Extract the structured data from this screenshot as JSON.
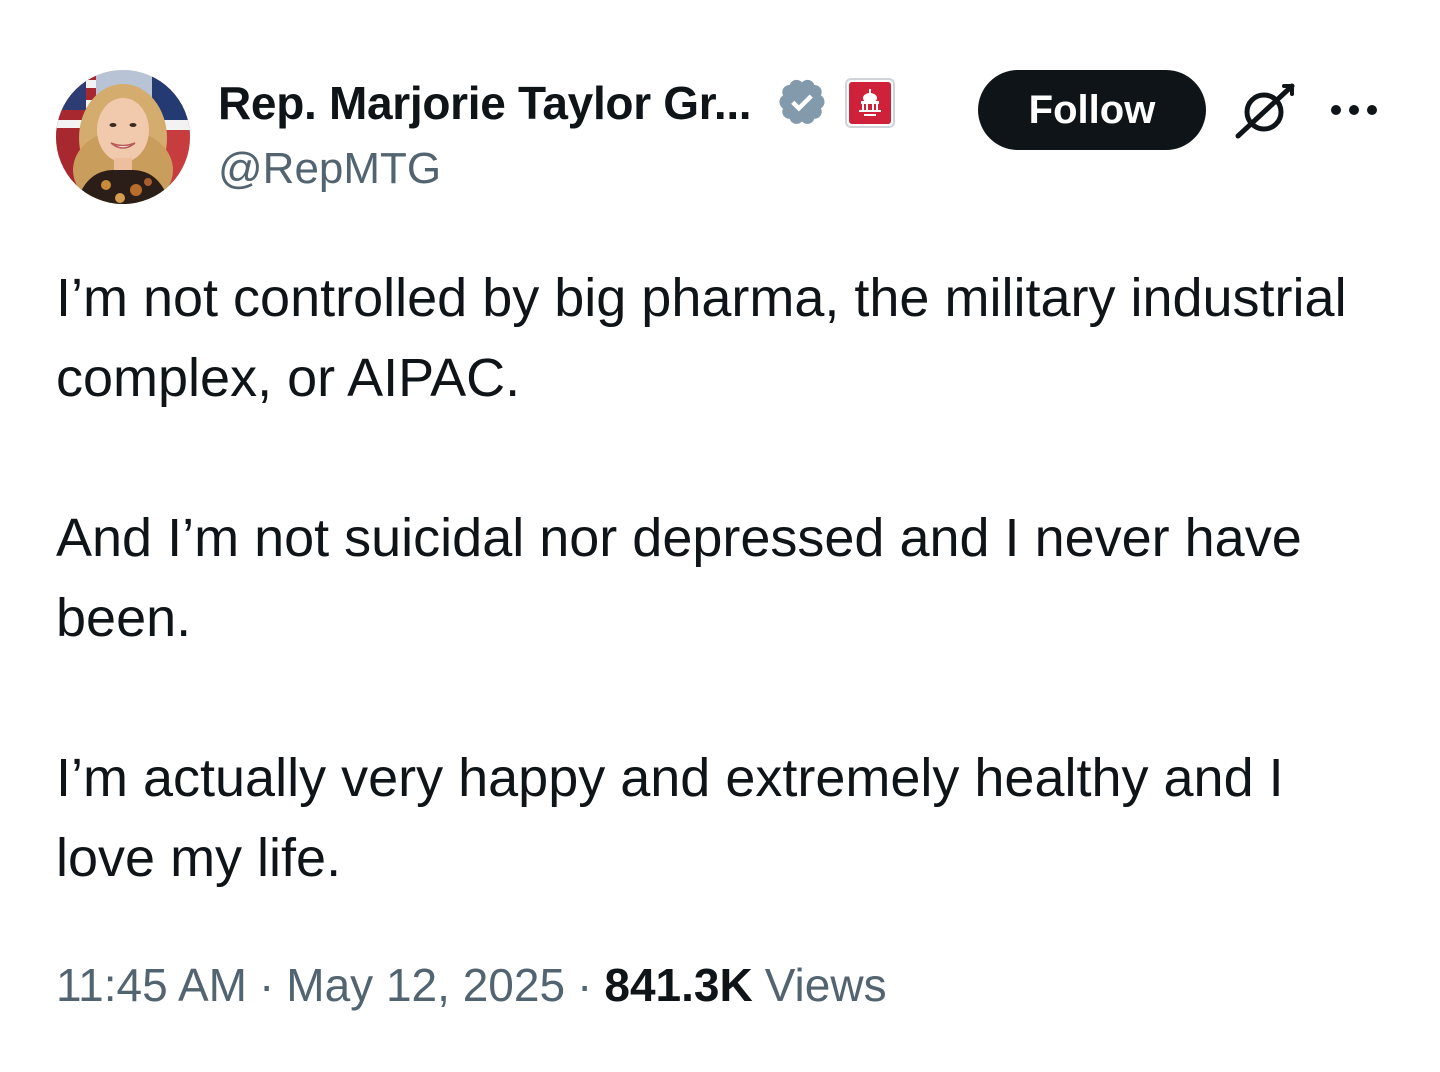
{
  "author": {
    "display_name": "Rep. Marjorie Taylor Gr...",
    "handle": "@RepMTG",
    "verified_icon": "verified-badge-icon",
    "affiliation_icon": "house-gop-capitol-icon"
  },
  "actions": {
    "follow_label": "Follow",
    "grok_icon": "grok-icon",
    "more_icon": "more-options-icon"
  },
  "tweet": {
    "paragraphs": [
      "I’m not controlled by big pharma, the military industrial complex, or AIPAC.",
      "And I’m not suicidal nor depressed and I never have been.",
      "I’m actually very happy and extremely healthy and I love my life."
    ]
  },
  "meta": {
    "time": "11:45 AM",
    "separator": "·",
    "date": "May 12, 2025",
    "views_count": "841.3K",
    "views_label": "Views"
  },
  "colors": {
    "text_primary": "#0f1419",
    "text_secondary": "#536471",
    "verified_badge": "#829aab",
    "affiliation_red": "#d0213a",
    "follow_bg": "#0f1419"
  }
}
